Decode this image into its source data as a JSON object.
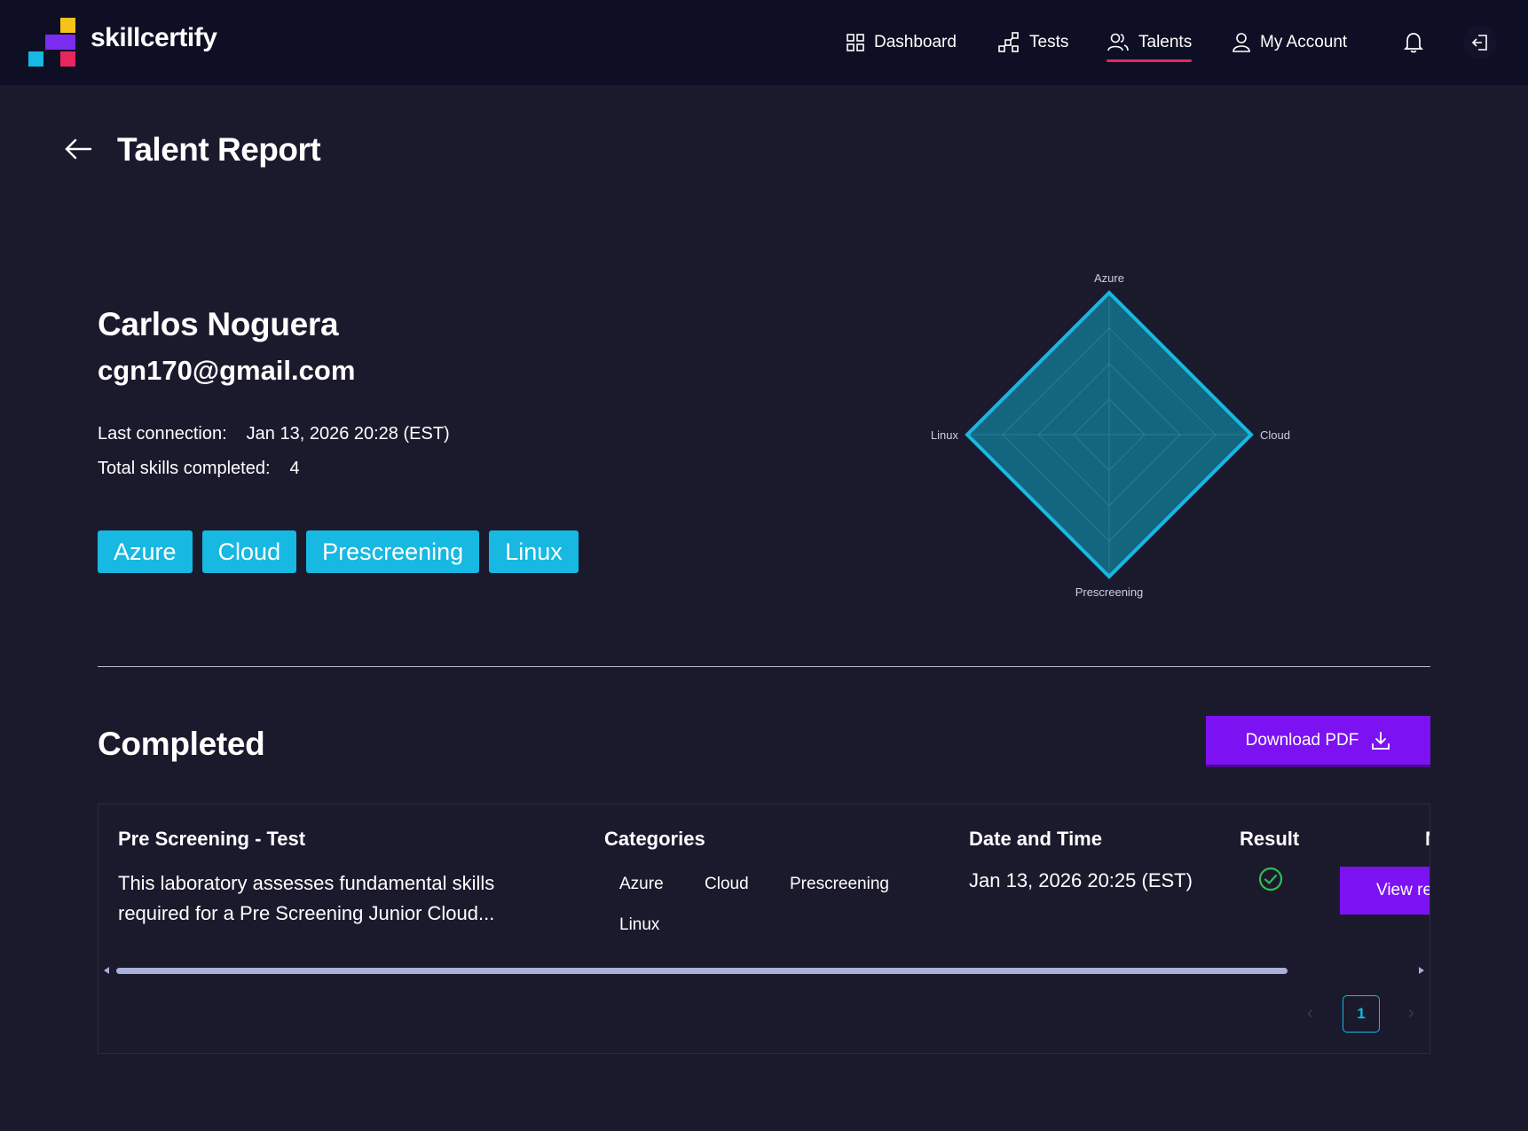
{
  "app": {
    "brand": "skillcertify"
  },
  "nav": {
    "items": [
      {
        "label": "Dashboard",
        "icon": "grid-icon"
      },
      {
        "label": "Tests",
        "icon": "tests-icon"
      },
      {
        "label": "Talents",
        "icon": "users-icon",
        "active": true
      },
      {
        "label": "My Account",
        "icon": "user-icon"
      }
    ],
    "active_color": "#e8265e"
  },
  "page": {
    "title": "Talent Report"
  },
  "talent": {
    "name": "Carlos Noguera",
    "email": "cgn170@gmail.com",
    "last_connection_label": "Last connection:",
    "last_connection_value": "Jan 13, 2026 20:28 (EST)",
    "skills_label": "Total skills completed:",
    "skills_value": "4",
    "tags": [
      "Azure",
      "Cloud",
      "Prescreening",
      "Linux"
    ]
  },
  "chart_data": {
    "type": "radar",
    "axes": [
      "Azure",
      "Cloud",
      "Prescreening",
      "Linux"
    ],
    "values": [
      100,
      100,
      100,
      100
    ],
    "max": 100,
    "color": "#17b8e2"
  },
  "completed": {
    "title": "Completed",
    "download_label": "Download PDF",
    "columns": {
      "test": "Pre Screening - Test",
      "categories": "Categories",
      "date": "Date and Time",
      "result": "Result",
      "more": "N"
    },
    "row": {
      "description": "This laboratory assesses fundamental skills required for a Pre Screening Junior Cloud...",
      "categories": [
        "Azure",
        "Cloud",
        "Prescreening",
        "Linux"
      ],
      "date": "Jan 13, 2026 20:25 (EST)",
      "result": "passed",
      "view_label": "View re"
    },
    "pagination": {
      "current": "1"
    }
  },
  "colors": {
    "accent": "#7c12f2",
    "tag": "#17b8e2",
    "success": "#2fbf4f"
  }
}
